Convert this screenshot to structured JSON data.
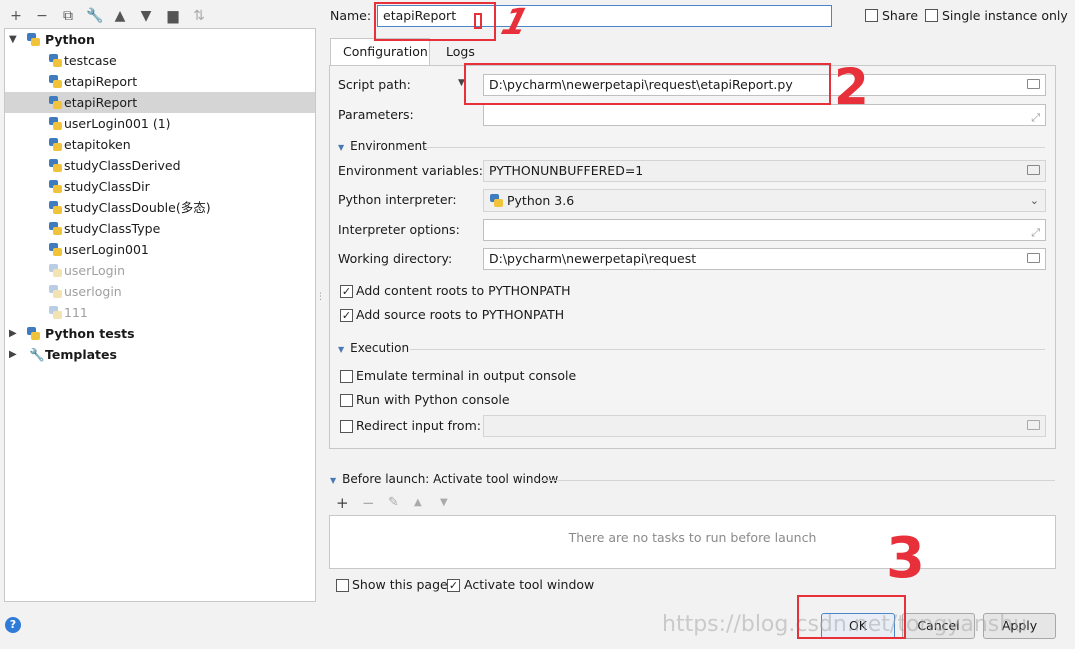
{
  "toolbar": {
    "icons": [
      "add-icon",
      "remove-icon",
      "copy-icon",
      "wrench-icon",
      "arrow-up-icon",
      "arrow-down-icon",
      "folder-add-icon",
      "sort-icon"
    ]
  },
  "tree": {
    "root_python": "Python",
    "items": [
      {
        "label": "testcase",
        "dim": false
      },
      {
        "label": "etapiReport",
        "dim": false
      },
      {
        "label": "etapiReport",
        "dim": false,
        "selected": true
      },
      {
        "label": "userLogin001 (1)",
        "dim": false
      },
      {
        "label": "etapitoken",
        "dim": false
      },
      {
        "label": "studyClassDerived",
        "dim": false
      },
      {
        "label": "studyClassDir",
        "dim": false
      },
      {
        "label": "studyClassDouble(多态)",
        "dim": false
      },
      {
        "label": "studyClassType",
        "dim": false
      },
      {
        "label": "userLogin001",
        "dim": false
      },
      {
        "label": "userLogin",
        "dim": true
      },
      {
        "label": "userlogin",
        "dim": true
      },
      {
        "label": "111",
        "dim": true
      }
    ],
    "python_tests": "Python tests",
    "templates": "Templates"
  },
  "name_label": "Name:",
  "name_value": "etapiReport",
  "share_label": "Share",
  "single_instance_label": "Single instance only",
  "tabs": {
    "configuration": "Configuration",
    "logs": "Logs"
  },
  "script_path_label": "Script path:",
  "script_path_value": "D:\\pycharm\\newerpetapi\\request\\etapiReport.py",
  "parameters_label": "Parameters:",
  "environment_section": "Environment",
  "env_vars_label": "Environment variables:",
  "env_vars_value": "PYTHONUNBUFFERED=1",
  "interpreter_label": "Python interpreter:",
  "interpreter_value": "Python 3.6",
  "interp_options_label": "Interpreter options:",
  "working_dir_label": "Working directory:",
  "working_dir_value": "D:\\pycharm\\newerpetapi\\request",
  "add_content_roots": "Add content roots to PYTHONPATH",
  "add_source_roots": "Add source roots to PYTHONPATH",
  "execution_section": "Execution",
  "emulate_terminal": "Emulate terminal in output console",
  "run_python_console": "Run with Python console",
  "redirect_input": "Redirect input from:",
  "before_launch": "Before launch: Activate tool window",
  "no_tasks": "There are no tasks to run before launch",
  "show_page": "Show this page",
  "activate_tool_window": "Activate tool window",
  "buttons": {
    "ok": "OK",
    "cancel": "Cancel",
    "apply": "Apply"
  },
  "watermark": "https://blog.csdn.net/tongyanshu",
  "annotations": {
    "one": "1",
    "two": "2",
    "three": "3"
  },
  "colors": {
    "annotation_red": "#e8303a",
    "selection": "#d5d5d5",
    "python_blue": "#3e7bbf",
    "python_yellow": "#f1c33b"
  }
}
